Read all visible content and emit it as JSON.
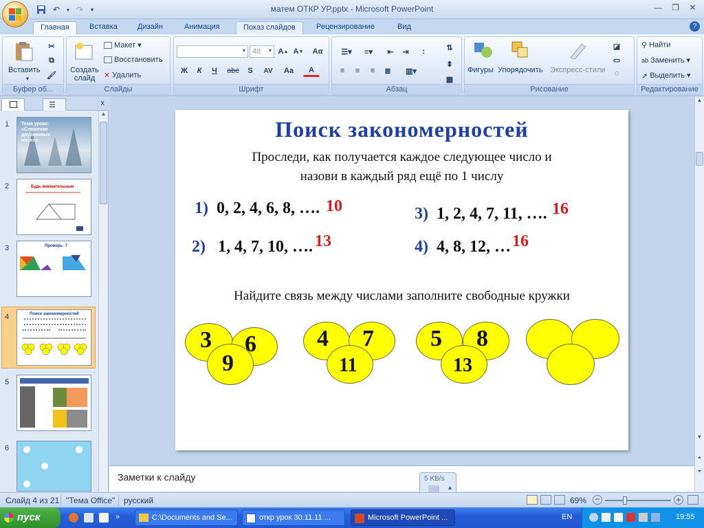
{
  "window": {
    "title": "матем ОТКР УР.pptx - Microsoft PowerPoint"
  },
  "tabs": [
    "Главная",
    "Вставка",
    "Дизайн",
    "Анимация",
    "Показ слайдов",
    "Рецензирование",
    "Вид"
  ],
  "ribbon": {
    "clipboard": {
      "paste": "Вставить",
      "label": "Буфер об..."
    },
    "slides": {
      "new_slide": "Создать слайд",
      "layout": "Макет",
      "reset": "Восстановить",
      "delete": "Удалить",
      "label": "Слайды"
    },
    "font": {
      "size": "48",
      "label": "Шрифт",
      "bold": "Ж",
      "italic": "К",
      "underline": "Ч",
      "strike": "abc",
      "shadow": "S",
      "spacing": "AV",
      "case": "Aa",
      "color": "A"
    },
    "paragraph": {
      "label": "Абзац"
    },
    "drawing": {
      "shapes": "Фигуры",
      "arrange": "Упорядочить",
      "quick_styles": "Экспресс-стили",
      "label": "Рисование"
    },
    "editing": {
      "find": "Найти",
      "replace": "Заменить",
      "select": "Выделить",
      "label": "Редактирование"
    }
  },
  "thumbnails": [
    {
      "num": "1",
      "title": "Тема урока: «Сложение двузначных чисел»"
    },
    {
      "num": "2",
      "title": "Будь внимательным"
    },
    {
      "num": "3",
      "title": "Проверь: 7"
    },
    {
      "num": "4",
      "title": "Поиск закономерностей"
    },
    {
      "num": "5",
      "title": ""
    },
    {
      "num": "6",
      "title": ""
    }
  ],
  "slide": {
    "title": "Поиск  закономерностей",
    "subtitle_line1": "Проследи, как получается каждое следующее число и",
    "subtitle_line2": "назови  в  каждый  ряд ещё по 1 числу",
    "seq1_num": "1)",
    "seq1": "0, 2, 4, 6, 8, ….",
    "seq1_ans": "10",
    "seq2_num": "2)",
    "seq2": "1, 4, 7, 10, ….",
    "seq2_ans": "13",
    "seq3_num": "3)",
    "seq3": "1, 2, 4, 7, 11, ….",
    "seq3_ans": "16",
    "seq4_num": "4)",
    "seq4": "4, 8, 12, …",
    "seq4_ans": "16",
    "instruction": "Найдите связь между числами заполните свободные кружки",
    "groups": [
      {
        "a": "3",
        "b": "6",
        "c": "9"
      },
      {
        "a": "4",
        "b": "7",
        "c": "11"
      },
      {
        "a": "5",
        "b": "8",
        "c": "13"
      },
      {
        "a": "",
        "b": "",
        "c": ""
      }
    ]
  },
  "notes": {
    "placeholder": "Заметки к слайду"
  },
  "speed_widget": {
    "text": "5 KB/s"
  },
  "status": {
    "slide_info": "Слайд 4 из 21",
    "theme": "\"Тема Office\"",
    "language": "русский",
    "zoom": "69%"
  },
  "taskbar": {
    "start": "пуск",
    "tasks": [
      "C:\\Documents and Se...",
      "откр урок 30.11.11 ...",
      "Microsoft PowerPoint ..."
    ],
    "lang": "EN",
    "clock": "19:55"
  },
  "colors": {
    "title_blue": "#1f3fa8",
    "answer_red": "#e0191a",
    "circle_yellow": "#ffff00",
    "selection_orange": "#f3a748"
  }
}
